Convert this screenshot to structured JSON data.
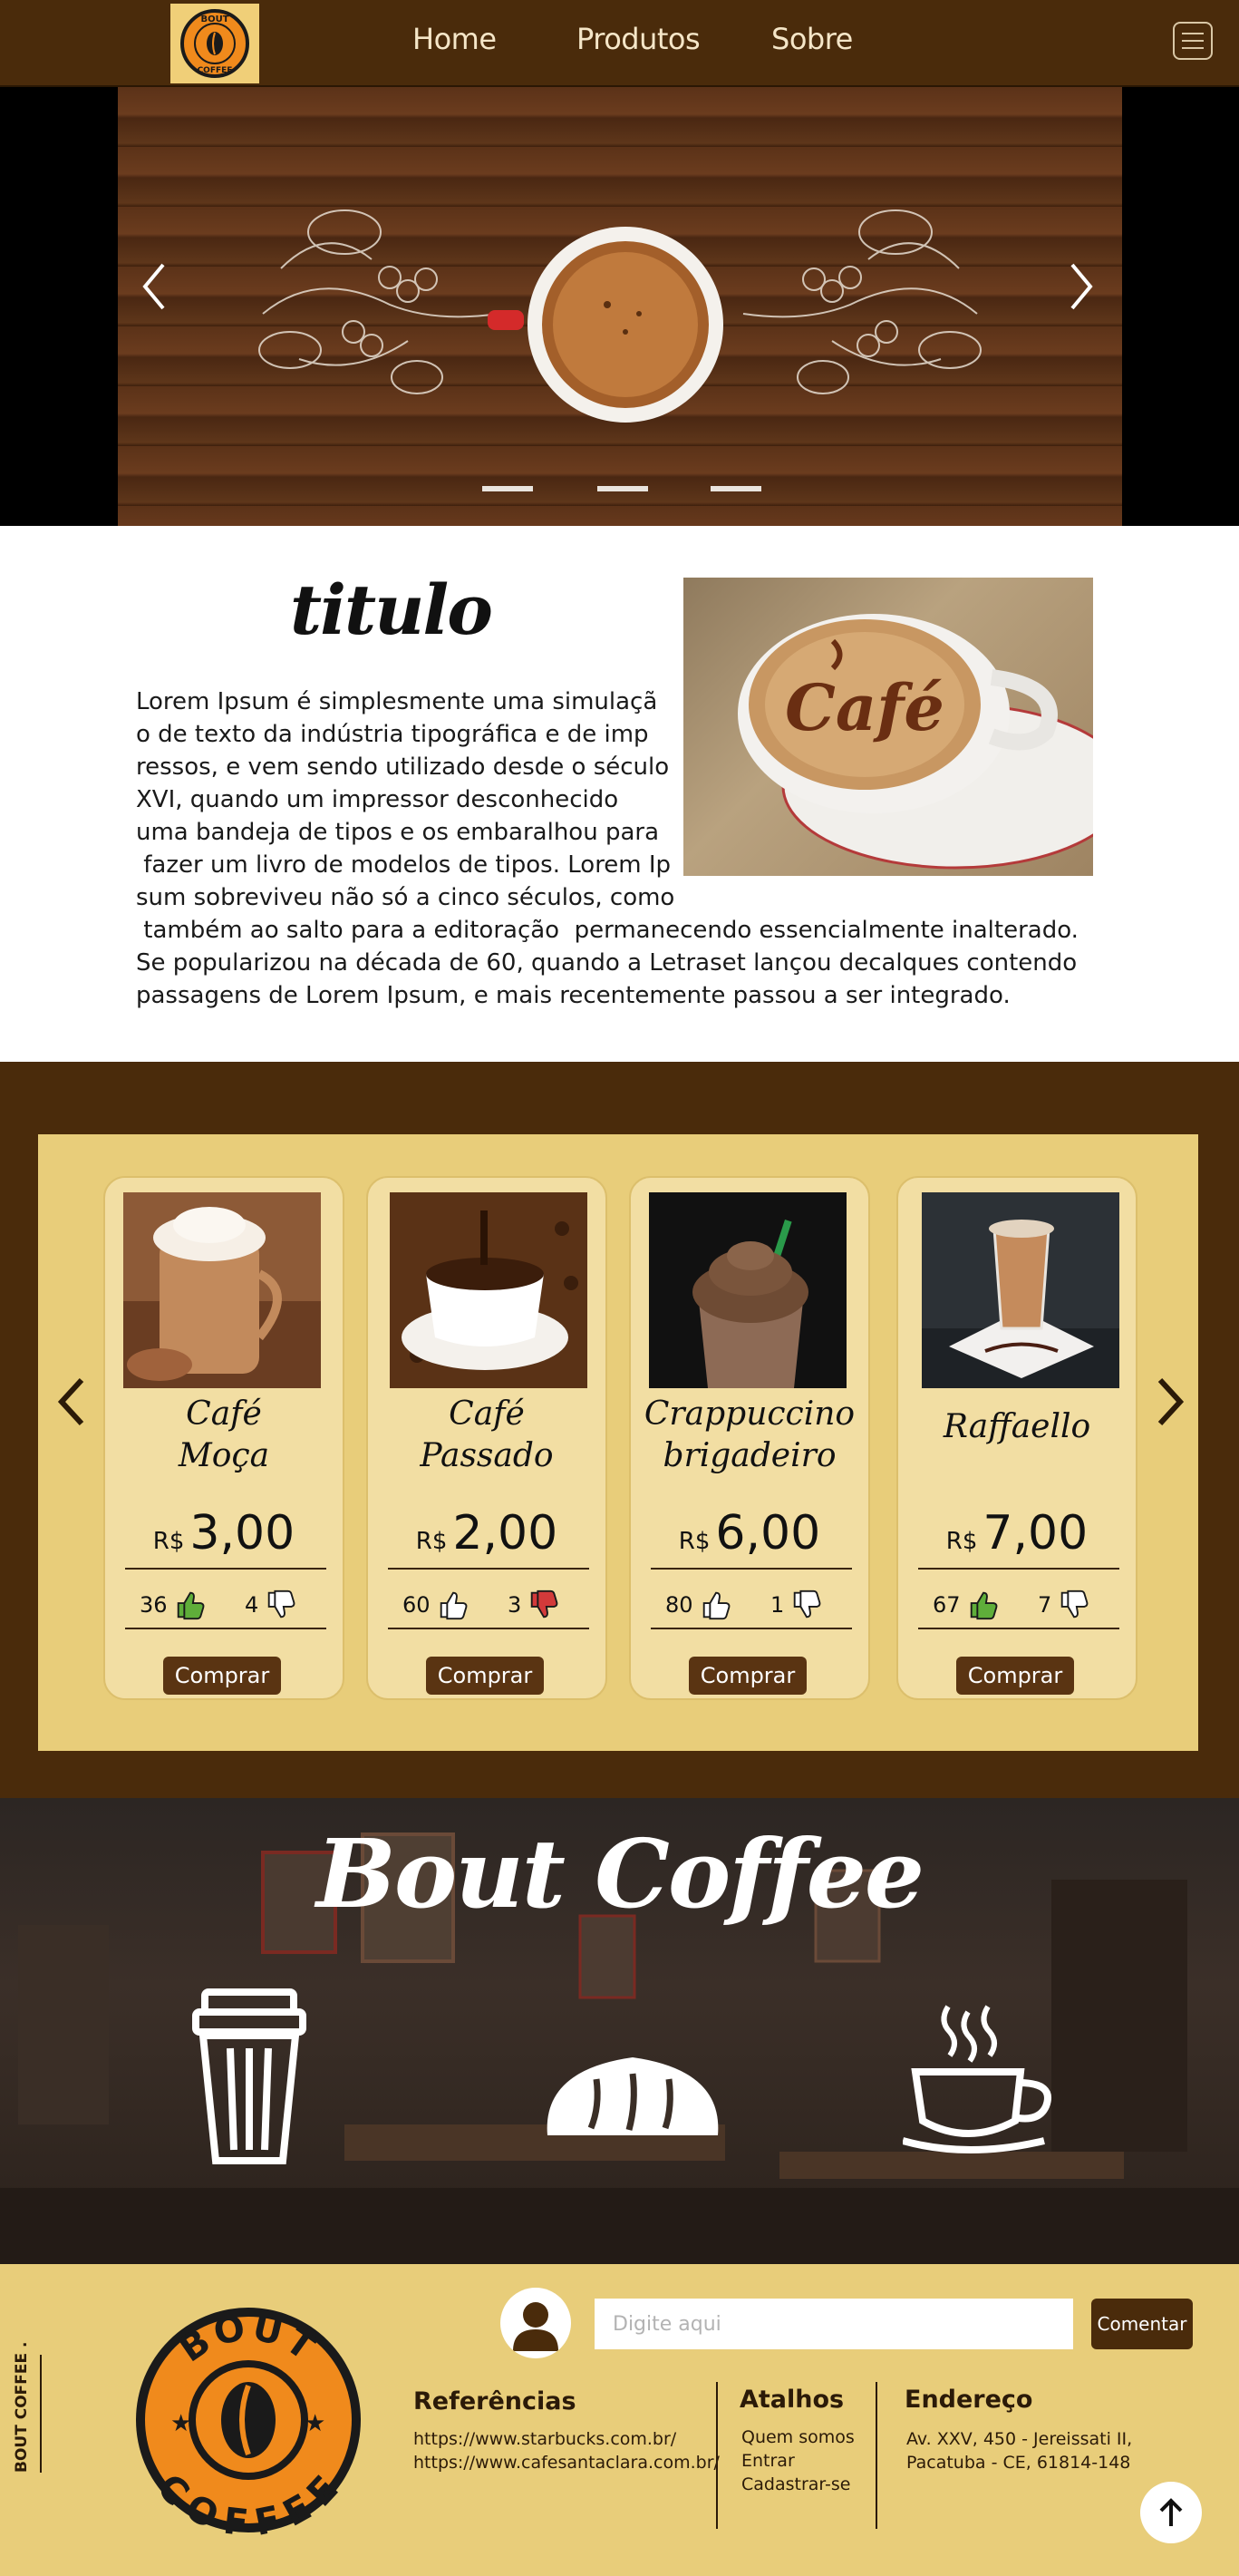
{
  "nav": {
    "logo_text": "BOUT COFFEE",
    "links": [
      {
        "label": "Home"
      },
      {
        "label": "Produtos"
      },
      {
        "label": "Sobre"
      }
    ],
    "menu_icon": "hamburger-icon"
  },
  "hero": {
    "slides_count": 3,
    "active_slide": 1,
    "prev_icon": "chevron-left-icon",
    "next_icon": "chevron-right-icon"
  },
  "intro": {
    "title": "titulo",
    "text_lines": [
      "Lorem Ipsum é simplesmente uma simulaçã",
      "o de texto da indústria tipográfica e de imp",
      "ressos, e vem sendo utilizado desde o século",
      "XVI, quando um impressor desconhecido",
      "uma bandeja de tipos e os embaralhou para",
      " fazer um livro de modelos de tipos. Lorem Ip",
      "sum sobreviveu não só a cinco séculos, como",
      " também ao salto para a editoração  permanecendo essencialmente inalterado.",
      "Se popularizou na década de 60, quando a Letraset lançou decalques contendo",
      "passagens de Lorem Ipsum, e mais recentemente passou a ser integrado."
    ],
    "photo_text": "Café"
  },
  "products": {
    "prev_icon": "chevron-left-icon",
    "next_icon": "chevron-right-icon",
    "currency": "R$",
    "buy_label": "Comprar",
    "items": [
      {
        "name_line1": "Café",
        "name_line2": "Moça",
        "price": "3,00",
        "likes": "36",
        "dislikes": "4",
        "like_color": "#5fae3a",
        "dislike_color": "#ffffff"
      },
      {
        "name_line1": "Café",
        "name_line2": "Passado",
        "price": "2,00",
        "likes": "60",
        "dislikes": "3",
        "like_color": "#ffffff",
        "dislike_color": "#d23a3a"
      },
      {
        "name_line1": "Crappuccino",
        "name_line2": "brigadeiro",
        "price": "6,00",
        "likes": "80",
        "dislikes": "1",
        "like_color": "#ffffff",
        "dislike_color": "#ffffff"
      },
      {
        "name_line1": "Raffaello",
        "name_line2": "",
        "price": "7,00",
        "likes": "67",
        "dislikes": "7",
        "like_color": "#5fae3a",
        "dislike_color": "#ffffff"
      }
    ]
  },
  "banner": {
    "title": "Bout Coffee",
    "icons": [
      "takeaway-cup-icon",
      "bread-icon",
      "hot-coffee-cup-icon"
    ]
  },
  "footer": {
    "vertical_text": "BOUT COFFEE .",
    "logo_text_top": "BOUT",
    "logo_text_bottom": "COFFEE",
    "comment_placeholder": "Digite aqui",
    "comment_button": "Comentar",
    "references": {
      "title": "Referências",
      "links": [
        "https://www.starbucks.com.br/",
        "https://www.cafesantaclara.com.br/"
      ]
    },
    "shortcuts": {
      "title": "Atalhos",
      "links": [
        "Quem somos",
        "Entrar",
        "Cadastrar-se"
      ]
    },
    "address": {
      "title": "Endereço",
      "lines": [
        "Av. XXV, 450 - Jereissati II,",
        "Pacatuba - CE, 61814-148"
      ]
    },
    "scroll_top_icon": "arrow-up-icon"
  },
  "colors": {
    "brand_brown": "#4a2b0b",
    "brand_yellow": "#e8cd7a",
    "card_bg": "#f2dea3",
    "button_brown": "#5a3412"
  }
}
